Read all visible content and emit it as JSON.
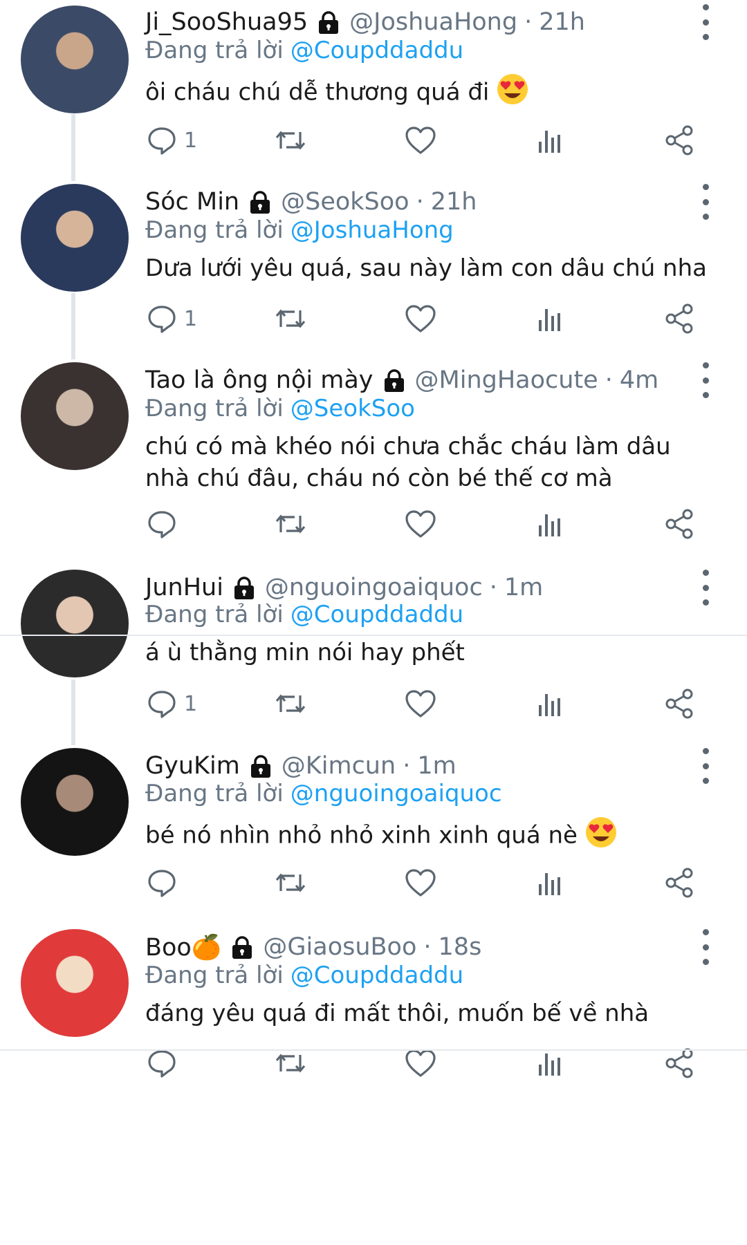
{
  "reply_prefix": "Đang trả lời",
  "replies": [
    {
      "name": "Ji_SooShua95",
      "handle": "@JoshuaHong",
      "time": "21h",
      "reply_to": "@Coupddaddu",
      "text": "ôi cháu chú dễ thương quá đi",
      "emoji": "heart-eyes",
      "reply_count": "1",
      "avatar_colors": [
        "#3b4a66",
        "#c9a58a"
      ]
    },
    {
      "name": "Sóc Min",
      "handle": "@SeokSoo",
      "time": "21h",
      "reply_to": "@JoshuaHong",
      "text": "Dưa lưới yêu quá, sau này làm con dâu chú nha",
      "emoji": "",
      "reply_count": "1",
      "avatar_colors": [
        "#2a3a5c",
        "#d6b49a"
      ]
    },
    {
      "name": "Tao là ông nội mày",
      "handle": "@MingHaocute",
      "time": "4m",
      "reply_to": "@SeokSoo",
      "text": "chú có mà khéo nói chưa chắc cháu làm dâu nhà chú đâu, cháu nó còn bé thế cơ mà",
      "emoji": "",
      "reply_count": "",
      "avatar_colors": [
        "#3a3230",
        "#cdb8a8"
      ]
    },
    {
      "name": "JunHui",
      "handle": "@nguoingoaiquoc",
      "time": "1m",
      "reply_to": "@Coupddaddu",
      "text": "á ù thằng min nói hay phết",
      "emoji": "",
      "reply_count": "1",
      "avatar_colors": [
        "#2b2b2b",
        "#e3c7b3"
      ]
    },
    {
      "name": "GyuKim",
      "handle": "@Kimcun",
      "time": "1m",
      "reply_to": "@nguoingoaiquoc",
      "text": "bé nó nhìn nhỏ nhỏ xinh xinh quá nè",
      "emoji": "heart-eyes",
      "reply_count": "",
      "avatar_colors": [
        "#141414",
        "#a88a78"
      ]
    },
    {
      "name": "Boo🍊",
      "handle": "@GiaosuBoo",
      "time": "18s",
      "reply_to": "@Coupddaddu",
      "text": "đáng yêu quá đi mất thôi, muốn bế về nhà",
      "emoji": "",
      "reply_count": "",
      "avatar_colors": [
        "#e03a3a",
        "#f2dcc4"
      ]
    }
  ],
  "icons": [
    "lock-icon",
    "reply-icon",
    "retweet-icon",
    "like-icon",
    "views-icon",
    "share-icon",
    "more-options-icon"
  ],
  "colors": {
    "link": "#1da1f2",
    "muted": "#687684",
    "text": "#1b1b1b"
  }
}
